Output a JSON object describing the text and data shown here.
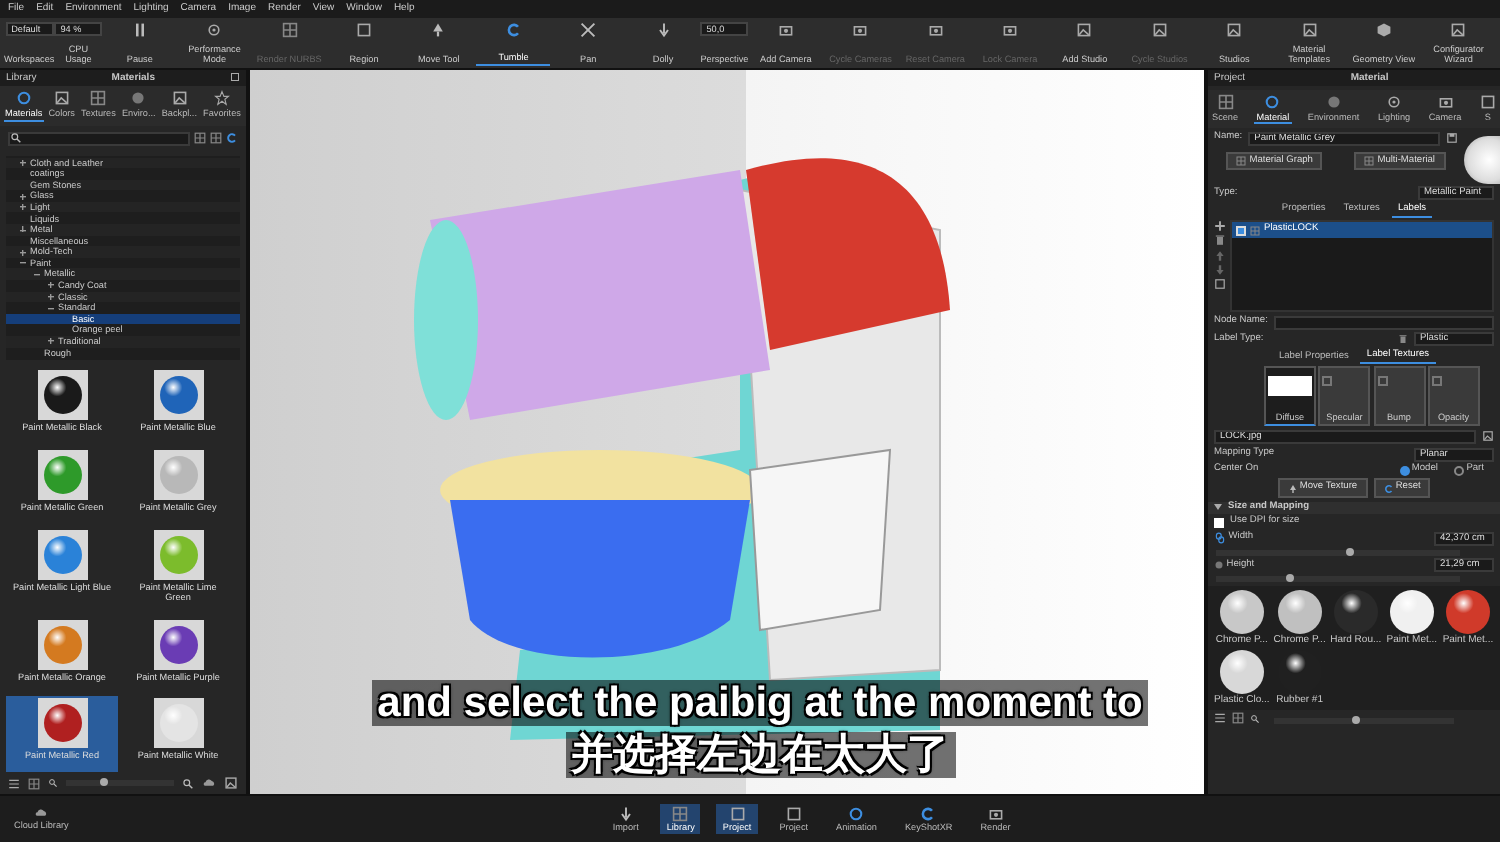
{
  "menu": [
    "File",
    "Edit",
    "Environment",
    "Lighting",
    "Camera",
    "Image",
    "Render",
    "View",
    "Window",
    "Help"
  ],
  "toolbar": [
    {
      "label": "Workspaces",
      "kind": "field",
      "value": "Default"
    },
    {
      "label": "CPU Usage",
      "kind": "field",
      "value": "94 %"
    },
    {
      "label": "Pause",
      "kind": "button",
      "disabled": false,
      "selected": false
    },
    {
      "label": "Performance Mode",
      "kind": "button",
      "disabled": false,
      "selected": false
    },
    {
      "label": "Render NURBS",
      "kind": "button",
      "disabled": true,
      "selected": false
    },
    {
      "label": "Region",
      "kind": "button",
      "disabled": false,
      "selected": false
    },
    {
      "label": "Move Tool",
      "kind": "button",
      "disabled": false,
      "selected": false
    },
    {
      "label": "Tumble",
      "kind": "button",
      "disabled": false,
      "selected": true
    },
    {
      "label": "Pan",
      "kind": "button",
      "disabled": false,
      "selected": false
    },
    {
      "label": "Dolly",
      "kind": "button",
      "disabled": false,
      "selected": false
    },
    {
      "label": "Perspective",
      "kind": "field",
      "value": "50,0"
    },
    {
      "label": "Add Camera",
      "kind": "button",
      "disabled": false,
      "selected": false
    },
    {
      "label": "Cycle Cameras",
      "kind": "button",
      "disabled": true,
      "selected": false
    },
    {
      "label": "Reset Camera",
      "kind": "button",
      "disabled": true,
      "selected": false
    },
    {
      "label": "Lock Camera",
      "kind": "button",
      "disabled": true,
      "selected": false
    },
    {
      "label": "Add Studio",
      "kind": "button",
      "disabled": false,
      "selected": false
    },
    {
      "label": "Cycle Studios",
      "kind": "button",
      "disabled": true,
      "selected": false
    },
    {
      "label": "Studios",
      "kind": "button",
      "disabled": false,
      "selected": false
    },
    {
      "label": "Material Templates",
      "kind": "button",
      "disabled": false,
      "selected": false
    },
    {
      "label": "Geometry View",
      "kind": "button",
      "disabled": false,
      "selected": false
    },
    {
      "label": "Configurator Wizard",
      "kind": "button",
      "disabled": false,
      "selected": false
    }
  ],
  "library": {
    "title": "Library",
    "heading": "Materials",
    "tabs": [
      {
        "label": "Materials",
        "selected": true
      },
      {
        "label": "Colors",
        "selected": false
      },
      {
        "label": "Textures",
        "selected": false
      },
      {
        "label": "Enviro...",
        "selected": false
      },
      {
        "label": "Backpl...",
        "selected": false
      },
      {
        "label": "Favorites",
        "selected": false
      }
    ],
    "tree": [
      {
        "label": "Cloth and Leather",
        "kind": "group",
        "expanded": false,
        "selected": false
      },
      {
        "label": "coatings",
        "kind": "leaf",
        "selected": false
      },
      {
        "label": "Gem Stones",
        "kind": "leaf",
        "selected": false
      },
      {
        "label": "Glass",
        "kind": "group",
        "expanded": false,
        "selected": false
      },
      {
        "label": "Light",
        "kind": "group",
        "expanded": false,
        "selected": false
      },
      {
        "label": "Liquids",
        "kind": "leaf",
        "selected": false
      },
      {
        "label": "Metal",
        "kind": "group",
        "expanded": false,
        "selected": false
      },
      {
        "label": "Miscellaneous",
        "kind": "leaf",
        "selected": false
      },
      {
        "label": "Mold-Tech",
        "kind": "group",
        "expanded": false,
        "selected": false
      },
      {
        "label": "Paint",
        "kind": "group",
        "expanded": true,
        "selected": false,
        "children": [
          {
            "label": "Metallic",
            "kind": "group",
            "expanded": true,
            "selected": false,
            "children": [
              {
                "label": "Candy Coat",
                "kind": "group",
                "expanded": false,
                "selected": false
              },
              {
                "label": "Classic",
                "kind": "group",
                "expanded": false,
                "selected": false
              },
              {
                "label": "Standard",
                "kind": "group",
                "expanded": true,
                "selected": false,
                "children": [
                  {
                    "label": "Basic",
                    "kind": "leaf",
                    "selected": true
                  },
                  {
                    "label": "Orange peel",
                    "kind": "leaf",
                    "selected": false
                  }
                ]
              },
              {
                "label": "Traditional",
                "kind": "group",
                "expanded": false,
                "selected": false
              }
            ]
          },
          {
            "label": "Rough",
            "kind": "leaf",
            "selected": false
          }
        ]
      }
    ],
    "materials": [
      {
        "label": "Paint Metallic Black",
        "color": "#1a1a1a",
        "selected": false
      },
      {
        "label": "Paint Metallic Blue",
        "color": "#1f64b8",
        "selected": false
      },
      {
        "label": "Paint Metallic Green",
        "color": "#2e9a2a",
        "selected": false
      },
      {
        "label": "Paint Metallic Grey",
        "color": "#b8b8b8",
        "selected": false
      },
      {
        "label": "Paint Metallic Light Blue",
        "color": "#2a82d8",
        "selected": false
      },
      {
        "label": "Paint Metallic Lime Green",
        "color": "#7cbc2c",
        "selected": false
      },
      {
        "label": "Paint Metallic Orange",
        "color": "#d47a20",
        "selected": false
      },
      {
        "label": "Paint Metallic Purple",
        "color": "#6a3cb4",
        "selected": false
      },
      {
        "label": "Paint Metallic Red",
        "color": "#b02020",
        "selected": true
      },
      {
        "label": "Paint Metallic White",
        "color": "#e4e4e4",
        "selected": false
      }
    ],
    "zoom": {
      "level": 0.35
    }
  },
  "subtitles": [
    "and select the paibig at the moment to",
    "并选择左边在太大了"
  ],
  "project": {
    "title": "Project",
    "heading": "Material",
    "tabs": [
      {
        "label": "Scene",
        "selected": false
      },
      {
        "label": "Material",
        "selected": true
      },
      {
        "label": "Environment",
        "selected": false
      },
      {
        "label": "Lighting",
        "selected": false
      },
      {
        "label": "Camera",
        "selected": false
      },
      {
        "label": "S",
        "selected": false
      }
    ],
    "name_label": "Name:",
    "name": "Paint Metallic Grey",
    "buttons": [
      "Material Graph",
      "Multi-Material"
    ],
    "type_label": "Type:",
    "type": "Metallic Paint",
    "subtabs": [
      {
        "label": "Properties",
        "selected": false
      },
      {
        "label": "Textures",
        "selected": false
      },
      {
        "label": "Labels",
        "selected": true
      }
    ],
    "labels": [
      {
        "label": "PlasticLOCK",
        "checked": true,
        "selected": true
      }
    ],
    "node_name_label": "Node Name:",
    "label_type_label": "Label Type:",
    "label_type": "Plastic",
    "label_tabs": [
      {
        "label": "Label Properties",
        "selected": false
      },
      {
        "label": "Label Textures",
        "selected": true
      }
    ],
    "slots": [
      {
        "label": "Diffuse",
        "selected": true,
        "filled": true
      },
      {
        "label": "Specular",
        "selected": false,
        "filled": false
      },
      {
        "label": "Bump",
        "selected": false,
        "filled": false
      },
      {
        "label": "Opacity",
        "selected": false,
        "filled": false
      }
    ],
    "file": "LOCK.jpg",
    "mapping_label": "Mapping Type",
    "mapping": "Planar",
    "center_label": "Center On",
    "center_options": [
      {
        "label": "Model",
        "selected": true
      },
      {
        "label": "Part",
        "selected": false
      }
    ],
    "actions": [
      "Move Texture",
      "Reset"
    ],
    "section": {
      "label": "Size and Mapping",
      "expanded": true
    },
    "dpi": {
      "label": "Use DPI for size",
      "checked": false
    },
    "sizes": [
      {
        "label": "Width",
        "value": "42,370 cm",
        "level": 0.55
      },
      {
        "label": "Height",
        "value": "21,29 cm",
        "level": 0.3
      }
    ],
    "scene_materials": [
      {
        "label": "Chrome P...",
        "color": "#c8c8c8"
      },
      {
        "label": "Chrome P...",
        "color": "#c0c0c0"
      },
      {
        "label": "Hard Rou...",
        "color": "#2a2a2a"
      },
      {
        "label": "Paint Met...",
        "color": "#f0f0f0"
      },
      {
        "label": "Paint Met...",
        "color": "#d03a2a"
      },
      {
        "label": "Plastic Clo...",
        "color": "#d8d8d8"
      },
      {
        "label": "Rubber #1",
        "color": "#202020"
      }
    ],
    "zoom": {
      "level": 0.45
    }
  },
  "statusbar": {
    "cloud": "Cloud Library",
    "items": [
      {
        "label": "Import",
        "selected": false
      },
      {
        "label": "Library",
        "selected": true
      },
      {
        "label": "Project",
        "selected": true
      },
      {
        "label": "Project",
        "selected": false
      },
      {
        "label": "Animation",
        "selected": false
      },
      {
        "label": "KeyShotXR",
        "selected": false
      },
      {
        "label": "Render",
        "selected": false
      }
    ]
  }
}
